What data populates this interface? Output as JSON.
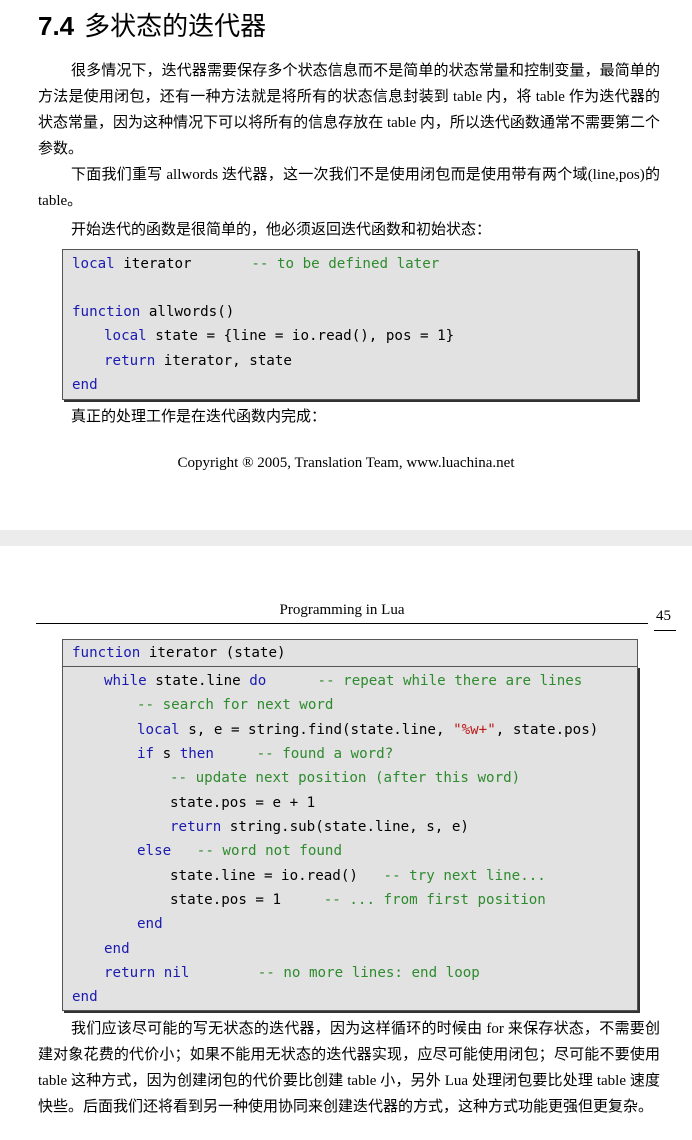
{
  "section": {
    "number": "7.4",
    "title": "多状态的迭代器"
  },
  "para1": "很多情况下，迭代器需要保存多个状态信息而不是简单的状态常量和控制变量，最简单的方法是使用闭包，还有一种方法就是将所有的状态信息封装到 table 内，将 table 作为迭代器的状态常量，因为这种情况下可以将所有的信息存放在 table 内，所以迭代函数通常不需要第二个参数。",
  "para2": "下面我们重写 allwords 迭代器，这一次我们不是使用闭包而是使用带有两个域(line,pos)的 table。",
  "para3": "开始迭代的函数是很简单的，他必须返回迭代函数和初始状态：",
  "code1": {
    "l1a": "local",
    "l1b": " iterator       ",
    "l1c": "-- to be defined later",
    "l3a": "function",
    "l3b": " allwords()",
    "l4a": "local",
    "l4b": " state = {line = io.read(), pos = 1}",
    "l5a": "return",
    "l5b": " iterator, state",
    "l6a": "end"
  },
  "para4": "真正的处理工作是在迭代函数内完成：",
  "copyright": "Copyright ® 2005, Translation Team, www.luachina.net",
  "header": {
    "title": "Programming in Lua",
    "page": "45"
  },
  "code2": {
    "h1a": "function",
    "h1b": " iterator (state)",
    "r1a": "while",
    "r1b": " state.line ",
    "r1c": "do",
    "r1d": "      -- repeat while there are lines",
    "r2": "-- search for next word",
    "r3a": "local",
    "r3b": " s, e = string.find(state.line, ",
    "r3c": "\"%w+\"",
    "r3d": ", state.pos)",
    "r4a": "if",
    "r4b": " s ",
    "r4c": "then",
    "r4d": "     -- found a word?",
    "r5": "-- update next position (after this word)",
    "r6": "state.pos = e + 1",
    "r7a": "return",
    "r7b": " string.sub(state.line, s, e)",
    "r8a": "else",
    "r8b": "   -- word not found",
    "r9a": "state.line = io.read()  ",
    "r9b": " -- try next line...",
    "r10a": "state.pos = 1     ",
    "r10b": "-- ... from first position",
    "r11": "end",
    "r12": "end",
    "r13a": "return",
    "r13b": " ",
    "r13c": "nil",
    "r13d": "        -- no more lines: end loop",
    "r14": "end"
  },
  "para5": "我们应该尽可能的写无状态的迭代器，因为这样循环的时候由 for 来保存状态，不需要创建对象花费的代价小；如果不能用无状态的迭代器实现，应尽可能使用闭包；尽可能不要使用 table 这种方式，因为创建闭包的代价要比创建 table 小，另外 Lua 处理闭包要比处理 table 速度快些。后面我们还将看到另一种使用协同来创建迭代器的方式，这种方式功能更强但更复杂。"
}
